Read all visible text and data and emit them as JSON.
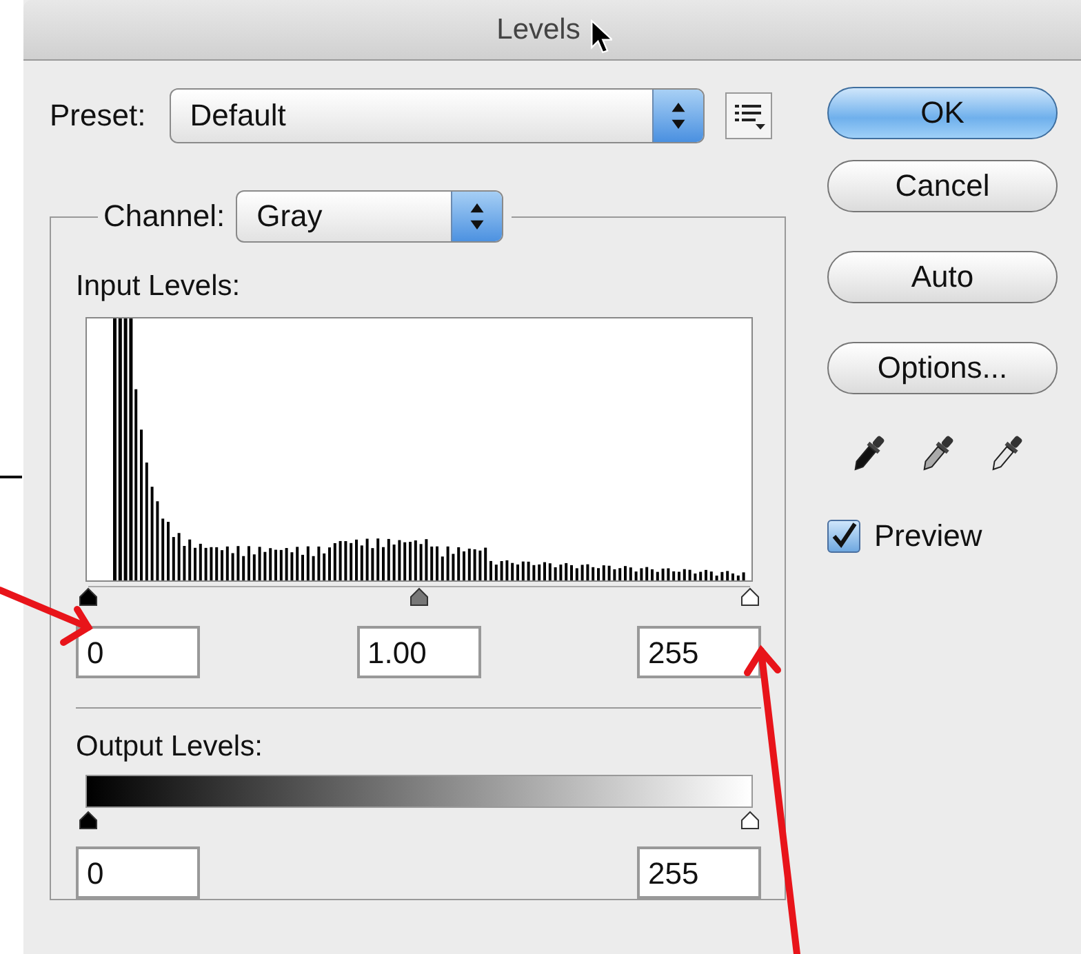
{
  "window": {
    "title": "Levels"
  },
  "preset": {
    "label": "Preset:",
    "value": "Default"
  },
  "channel": {
    "label": "Channel:",
    "value": "Gray"
  },
  "input_levels": {
    "label": "Input Levels:",
    "sliders": [
      {
        "kind": "black",
        "level": 0
      },
      {
        "kind": "gray",
        "level": 0.5
      },
      {
        "kind": "white",
        "level": 1
      }
    ],
    "fields": [
      "0",
      "1.00",
      "255"
    ]
  },
  "output_levels": {
    "label": "Output Levels:",
    "sliders": [
      {
        "kind": "black",
        "level": 0
      },
      {
        "kind": "white",
        "level": 1
      }
    ],
    "fields": [
      "0",
      "255"
    ]
  },
  "buttons": [
    {
      "label": "OK",
      "default": true
    },
    {
      "label": "Cancel",
      "default": false
    },
    {
      "label": "Auto",
      "default": false
    },
    {
      "label": "Options...",
      "default": false
    }
  ],
  "eyedroppers": [
    {
      "kind": "black"
    },
    {
      "kind": "gray"
    },
    {
      "kind": "white"
    }
  ],
  "preview": {
    "label": "Preview",
    "checked": true
  }
}
